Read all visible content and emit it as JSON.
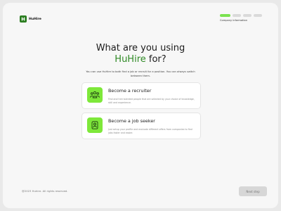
{
  "app": {
    "name": "HuHire"
  },
  "progress": {
    "label": "Company information",
    "total_steps": 5,
    "completed_steps": 1,
    "active_color": "#7ae24f",
    "inactive_color": "#dadada"
  },
  "main": {
    "title_prefix": "What are you using",
    "title_brand": "HuHire",
    "title_suffix": " for?",
    "subtitle": "You can use HuHire to both find a job or recruit for a position. You can always switch between them."
  },
  "options": [
    {
      "title": "Become a recruiter",
      "description": "Find and hire talented people that are selected by your choice of knowledge, skill and experience.",
      "icon": "team-icon"
    },
    {
      "title": "Become a job seeker",
      "description": "Just setup your profile and evaluate different offers from companies to find jobs faster and easier.",
      "icon": "person-icon"
    }
  ],
  "footer": {
    "copyright": "@2023 Huhire. All rights reserved.",
    "next_label": "Next step"
  },
  "colors": {
    "brand_green": "#2f8a25",
    "accent_lime": "#7ee83a",
    "background": "#f7f7f7"
  }
}
